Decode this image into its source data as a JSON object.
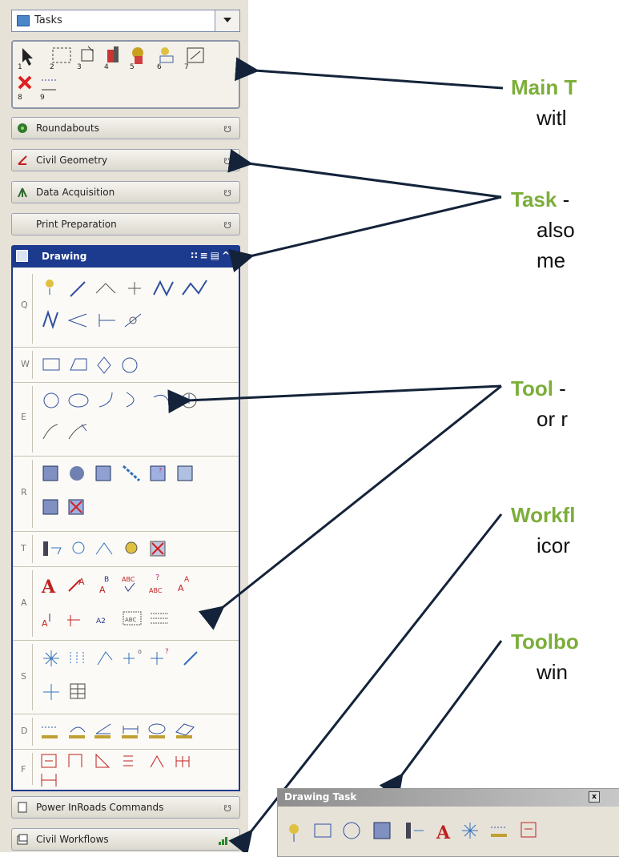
{
  "tasks_dropdown": {
    "label": "Tasks",
    "arrow": "dropdown-arrow-icon"
  },
  "main_toolbar": {
    "icons": [
      "select-element-icon",
      "fence-icon",
      "place-element-icon",
      "modify-element-icon",
      "change-attributes-icon",
      "delete-element-icon",
      "manipulate-icon",
      "delete-icon",
      "measure-icon"
    ],
    "numbers": [
      "1",
      "2",
      "3",
      "4",
      "5",
      "6",
      "7",
      "8",
      "9"
    ]
  },
  "task_bars": [
    {
      "label": "Roundabouts",
      "icon": "roundabout-icon"
    },
    {
      "label": "Civil Geometry",
      "icon": "civil-geometry-icon"
    },
    {
      "label": "Data Acquisition",
      "icon": "data-acquisition-icon"
    },
    {
      "label": "Print Preparation",
      "icon": ""
    }
  ],
  "drawing_task": {
    "label": "Drawing",
    "header_icons": "∷≡▤^",
    "rows": [
      {
        "letter": "Q"
      },
      {
        "letter": "W"
      },
      {
        "letter": "E"
      },
      {
        "letter": "R"
      },
      {
        "letter": "T"
      },
      {
        "letter": "A"
      },
      {
        "letter": "S"
      },
      {
        "letter": "D"
      },
      {
        "letter": "F"
      }
    ]
  },
  "bottom_bars": [
    {
      "label": "Power InRoads Commands",
      "icon": "power-inroads-icon"
    },
    {
      "label": "Civil Workflows",
      "icon": "civil-workflows-icon"
    }
  ],
  "annotations": [
    {
      "key": "Main T",
      "lines": [
        "",
        "witl"
      ]
    },
    {
      "key": "Task",
      "lines": [
        " - ",
        "also",
        "me"
      ]
    },
    {
      "key": "Tool",
      "lines": [
        " - ",
        "or r"
      ]
    },
    {
      "key": "Workfl",
      "lines": [
        "",
        "icor"
      ]
    },
    {
      "key": "Toolbo",
      "lines": [
        "",
        "win"
      ]
    }
  ],
  "floating_toolbox": {
    "title": "Drawing  Task",
    "close": "x"
  }
}
